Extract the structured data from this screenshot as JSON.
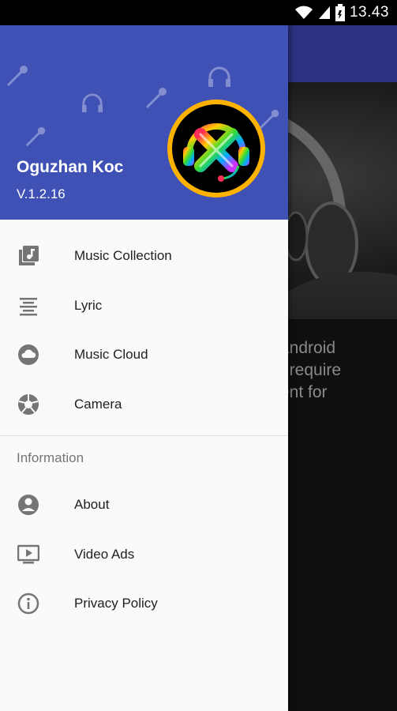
{
  "status_bar": {
    "time": "13.43",
    "icons": [
      "wifi-icon",
      "signal-icon",
      "battery-icon"
    ]
  },
  "drawer": {
    "header": {
      "name": "Oguzhan Koc",
      "version": "V.1.2.16",
      "background_color": "#3f51b5",
      "decor_icons": [
        "microphone-icon",
        "headphones-icon"
      ]
    },
    "items": [
      {
        "label": "Music Collection",
        "icon": "library-music-icon"
      },
      {
        "label": "Lyric",
        "icon": "text-lines-icon"
      },
      {
        "label": "Music Cloud",
        "icon": "cloud-icon"
      },
      {
        "label": "Camera",
        "icon": "camera-shutter-icon"
      }
    ],
    "section_title": "Information",
    "info_items": [
      {
        "label": "About",
        "icon": "account-circle-icon"
      },
      {
        "label": "Video Ads",
        "icon": "video-play-icon"
      },
      {
        "label": "Privacy Policy",
        "icon": "info-icon"
      }
    ]
  },
  "background": {
    "toolbar_color": "#2b3280",
    "text_lines": [
      "android",
      "t require",
      "ent for"
    ]
  }
}
